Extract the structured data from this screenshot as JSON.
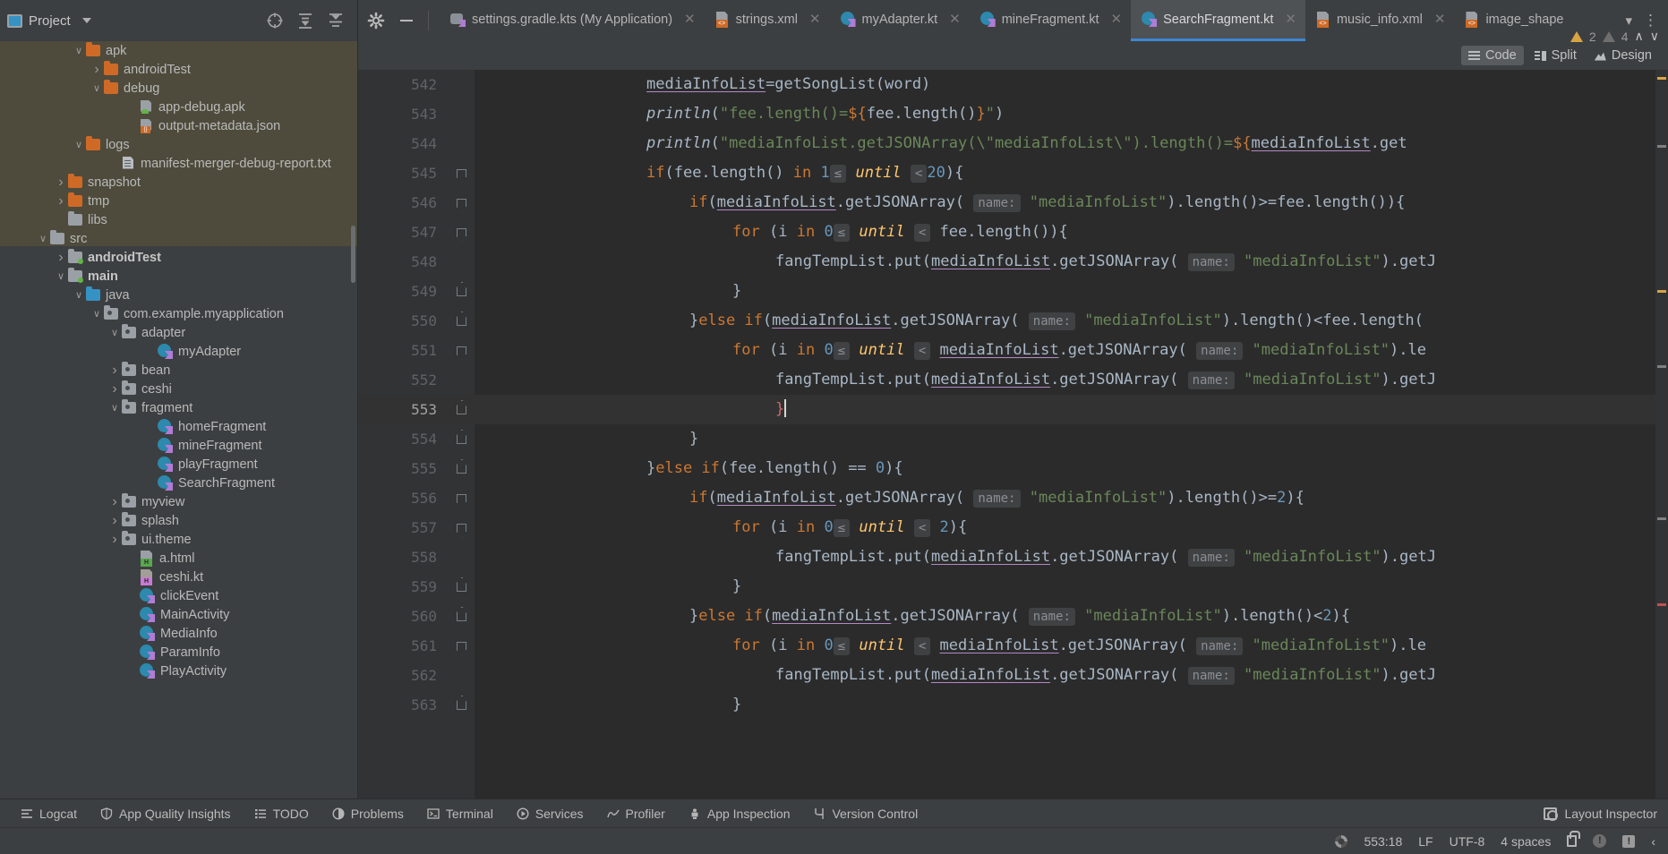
{
  "project_panel": {
    "title": "Project",
    "icons": [
      "target-icon",
      "collapse-all-icon",
      "expand-collapse-icon",
      "settings-gear-icon",
      "minimize-icon"
    ],
    "tree": [
      {
        "label": "apk",
        "indent": 4,
        "twisty": "v",
        "icon": "folder-orange",
        "bold": false,
        "hl": true
      },
      {
        "label": "androidTest",
        "indent": 5,
        "twisty": ">",
        "icon": "folder-orange",
        "bold": false,
        "hl": true
      },
      {
        "label": "debug",
        "indent": 5,
        "twisty": "v",
        "icon": "folder-orange",
        "bold": false,
        "hl": true
      },
      {
        "label": "app-debug.apk",
        "indent": 7,
        "twisty": "",
        "icon": "apk-file",
        "bold": false,
        "hl": true
      },
      {
        "label": "output-metadata.json",
        "indent": 7,
        "twisty": "",
        "icon": "json-file",
        "bold": false,
        "hl": true
      },
      {
        "label": "logs",
        "indent": 4,
        "twisty": "v",
        "icon": "folder-orange",
        "bold": false,
        "hl": true
      },
      {
        "label": "manifest-merger-debug-report.txt",
        "indent": 6,
        "twisty": "",
        "icon": "txt-file",
        "bold": false,
        "hl": true
      },
      {
        "label": "snapshot",
        "indent": 3,
        "twisty": ">",
        "icon": "folder-orange",
        "bold": false,
        "hl": true
      },
      {
        "label": "tmp",
        "indent": 3,
        "twisty": ">",
        "icon": "folder-orange",
        "bold": false,
        "hl": true
      },
      {
        "label": "libs",
        "indent": 3,
        "twisty": "",
        "icon": "folder-gray",
        "bold": false,
        "hl": false
      },
      {
        "label": "src",
        "indent": 2,
        "twisty": "v",
        "icon": "folder-gray",
        "bold": false,
        "hl": false
      },
      {
        "label": "androidTest",
        "indent": 3,
        "twisty": ">",
        "icon": "folder-src",
        "bold": true,
        "hl": false
      },
      {
        "label": "main",
        "indent": 3,
        "twisty": "v",
        "icon": "folder-src",
        "bold": true,
        "hl": false
      },
      {
        "label": "java",
        "indent": 4,
        "twisty": "v",
        "icon": "folder-blue",
        "bold": false,
        "hl": false
      },
      {
        "label": "com.example.myapplication",
        "indent": 5,
        "twisty": "v",
        "icon": "folder-pkg",
        "bold": false,
        "hl": false
      },
      {
        "label": "adapter",
        "indent": 6,
        "twisty": "v",
        "icon": "folder-pkg",
        "bold": false,
        "hl": false
      },
      {
        "label": "myAdapter",
        "indent": 8,
        "twisty": "",
        "icon": "kotlin-file",
        "bold": false,
        "hl": false
      },
      {
        "label": "bean",
        "indent": 6,
        "twisty": ">",
        "icon": "folder-pkg",
        "bold": false,
        "hl": false
      },
      {
        "label": "ceshi",
        "indent": 6,
        "twisty": ">",
        "icon": "folder-pkg",
        "bold": false,
        "hl": false
      },
      {
        "label": "fragment",
        "indent": 6,
        "twisty": "v",
        "icon": "folder-pkg",
        "bold": false,
        "hl": false
      },
      {
        "label": "homeFragment",
        "indent": 8,
        "twisty": "",
        "icon": "kotlin-file",
        "bold": false,
        "hl": false
      },
      {
        "label": "mineFragment",
        "indent": 8,
        "twisty": "",
        "icon": "kotlin-file",
        "bold": false,
        "hl": false
      },
      {
        "label": "playFragment",
        "indent": 8,
        "twisty": "",
        "icon": "kotlin-file",
        "bold": false,
        "hl": false
      },
      {
        "label": "SearchFragment",
        "indent": 8,
        "twisty": "",
        "icon": "kotlin-file",
        "bold": false,
        "hl": false
      },
      {
        "label": "myview",
        "indent": 6,
        "twisty": ">",
        "icon": "folder-pkg",
        "bold": false,
        "hl": false
      },
      {
        "label": "splash",
        "indent": 6,
        "twisty": ">",
        "icon": "folder-pkg",
        "bold": false,
        "hl": false
      },
      {
        "label": "ui.theme",
        "indent": 6,
        "twisty": ">",
        "icon": "folder-pkg",
        "bold": false,
        "hl": false
      },
      {
        "label": "a.html",
        "indent": 7,
        "twisty": "",
        "icon": "html-file",
        "bold": false,
        "hl": false
      },
      {
        "label": "ceshi.kt",
        "indent": 7,
        "twisty": "",
        "icon": "kotlin-script-file",
        "bold": false,
        "hl": false
      },
      {
        "label": "clickEvent",
        "indent": 7,
        "twisty": "",
        "icon": "kotlin-file",
        "bold": false,
        "hl": false
      },
      {
        "label": "MainActivity",
        "indent": 7,
        "twisty": "",
        "icon": "kotlin-file",
        "bold": false,
        "hl": false
      },
      {
        "label": "MediaInfo",
        "indent": 7,
        "twisty": "",
        "icon": "kotlin-file",
        "bold": false,
        "hl": false
      },
      {
        "label": "ParamInfo",
        "indent": 7,
        "twisty": "",
        "icon": "kotlin-file",
        "bold": false,
        "hl": false
      },
      {
        "label": "PlayActivity",
        "indent": 7,
        "twisty": "",
        "icon": "kotlin-file",
        "bold": false,
        "hl": false
      }
    ]
  },
  "tabs": [
    {
      "label": "settings.gradle.kts (My Application)",
      "icon": "gradle-file-icon",
      "active": false
    },
    {
      "label": "strings.xml",
      "icon": "xml-file-icon",
      "active": false
    },
    {
      "label": "myAdapter.kt",
      "icon": "kotlin-file-icon",
      "active": false
    },
    {
      "label": "mineFragment.kt",
      "icon": "kotlin-file-icon",
      "active": false
    },
    {
      "label": "SearchFragment.kt",
      "icon": "kotlin-file-icon",
      "active": true
    },
    {
      "label": "music_info.xml",
      "icon": "xml-file-icon",
      "active": false
    },
    {
      "label": "image_shape",
      "icon": "xml-file-icon",
      "active": false
    }
  ],
  "view_modes": [
    {
      "label": "Code",
      "active": true
    },
    {
      "label": "Split",
      "active": false
    },
    {
      "label": "Design",
      "active": false
    }
  ],
  "inspection": {
    "warning_count": "2",
    "weak_warning_count": "4",
    "up_label": "∧",
    "down_label": "∨"
  },
  "editor": {
    "first_line": 542,
    "current_line": 553,
    "lines": [
      {
        "n": 542,
        "fold": "",
        "cur": false,
        "html": "<span class=\"s-var\">mediaInfoList</span><span class=\"s-plain\">=getSongList(word)</span>"
      },
      {
        "n": 543,
        "fold": "",
        "cur": false,
        "html": "<span class=\"s-fn\">println</span><span class=\"s-plain\">(</span><span class=\"s-str\">\"fee.length()=</span><span class=\"s-tmpl\">${</span><span class=\"s-plain\">fee.length()</span><span class=\"s-tmpl\">}</span><span class=\"s-str\">\"</span><span class=\"s-plain\">)</span>"
      },
      {
        "n": 544,
        "fold": "",
        "cur": false,
        "html": "<span class=\"s-fn\">println</span><span class=\"s-plain\">(</span><span class=\"s-str\">\"mediaInfoList.getJSONArray(\\\"mediaInfoList\\\").length()=</span><span class=\"s-tmpl\">${</span><span class=\"s-var\">mediaInfoList</span><span class=\"s-plain\">.get</span>"
      },
      {
        "n": 545,
        "fold": "down",
        "cur": false,
        "html": "<span class=\"s-kw\">if</span><span class=\"s-plain\">(fee.length()</span> <span class=\"s-kw\">in</span> <span class=\"s-num\">1</span><span class=\"hint\">≤</span> <span class=\"s-soft\">until</span> <span class=\"hint\">&lt;</span><span class=\"s-num\">20</span><span class=\"s-plain\">){</span>"
      },
      {
        "n": 546,
        "fold": "down",
        "cur": false,
        "html": "<span class=\"s-kw\">if</span><span class=\"s-plain\">(</span><span class=\"s-var\">mediaInfoList</span><span class=\"s-plain\">.getJSONArray(</span> <span class=\"hint\">name:</span> <span class=\"s-str\">\"mediaInfoList\"</span><span class=\"s-plain\">).length()&gt;=fee.length()){</span>"
      },
      {
        "n": 547,
        "fold": "down",
        "cur": false,
        "html": "<span class=\"s-kw\">for</span> <span class=\"s-plain\">(i</span> <span class=\"s-kw\">in</span> <span class=\"s-num\">0</span><span class=\"hint\">≤</span> <span class=\"s-soft\">until</span> <span class=\"hint\">&lt;</span><span class=\"s-plain\"> fee.length()){</span>"
      },
      {
        "n": 548,
        "fold": "",
        "cur": false,
        "html": "<span class=\"s-plain\">fangTempList.put(</span><span class=\"s-var\">mediaInfoList</span><span class=\"s-plain\">.getJSONArray(</span> <span class=\"hint\">name:</span> <span class=\"s-str\">\"mediaInfoList\"</span><span class=\"s-plain\">).getJ</span>"
      },
      {
        "n": 549,
        "fold": "up",
        "cur": false,
        "html": "<span class=\"s-plain\">}</span>"
      },
      {
        "n": 550,
        "fold": "up",
        "cur": false,
        "html": "<span class=\"s-plain\">}</span><span class=\"s-kw\">else if</span><span class=\"s-plain\">(</span><span class=\"s-var\">mediaInfoList</span><span class=\"s-plain\">.getJSONArray(</span> <span class=\"hint\">name:</span> <span class=\"s-str\">\"mediaInfoList\"</span><span class=\"s-plain\">).length()&lt;fee.length(</span>"
      },
      {
        "n": 551,
        "fold": "down",
        "cur": false,
        "html": "<span class=\"s-kw\">for</span> <span class=\"s-plain\">(i</span> <span class=\"s-kw\">in</span> <span class=\"s-num\">0</span><span class=\"hint\">≤</span> <span class=\"s-soft\">until</span> <span class=\"hint\">&lt;</span> <span class=\"s-var\">mediaInfoList</span><span class=\"s-plain\">.getJSONArray(</span> <span class=\"hint\">name:</span> <span class=\"s-str\">\"mediaInfoList\"</span><span class=\"s-plain\">).le</span>"
      },
      {
        "n": 552,
        "fold": "",
        "cur": false,
        "html": "<span class=\"s-plain\">fangTempList.put(</span><span class=\"s-var\">mediaInfoList</span><span class=\"s-plain\">.getJSONArray(</span> <span class=\"hint\">name:</span> <span class=\"s-str\">\"mediaInfoList\"</span><span class=\"s-plain\">).getJ</span>"
      },
      {
        "n": 553,
        "fold": "up",
        "cur": true,
        "html": "<span class=\"brk-red\">}</span><span class=\"caret\"></span>"
      },
      {
        "n": 554,
        "fold": "up",
        "cur": false,
        "html": "<span class=\"s-plain\">}</span>"
      },
      {
        "n": 555,
        "fold": "up",
        "cur": false,
        "html": "<span class=\"s-plain\">}</span><span class=\"s-kw\">else if</span><span class=\"s-plain\">(fee.length() == </span><span class=\"s-num\">0</span><span class=\"s-plain\">){</span>"
      },
      {
        "n": 556,
        "fold": "down",
        "cur": false,
        "html": "<span class=\"s-kw\">if</span><span class=\"s-plain\">(</span><span class=\"s-var\">mediaInfoList</span><span class=\"s-plain\">.getJSONArray(</span> <span class=\"hint\">name:</span> <span class=\"s-str\">\"mediaInfoList\"</span><span class=\"s-plain\">).length()&gt;=</span><span class=\"s-num\">2</span><span class=\"s-plain\">){</span>"
      },
      {
        "n": 557,
        "fold": "down",
        "cur": false,
        "html": "<span class=\"s-kw\">for</span> <span class=\"s-plain\">(i</span> <span class=\"s-kw\">in</span> <span class=\"s-num\">0</span><span class=\"hint\">≤</span> <span class=\"s-soft\">until</span> <span class=\"hint\">&lt;</span> <span class=\"s-num\">2</span><span class=\"s-plain\">){</span>"
      },
      {
        "n": 558,
        "fold": "",
        "cur": false,
        "html": "<span class=\"s-plain\">fangTempList.put(</span><span class=\"s-var\">mediaInfoList</span><span class=\"s-plain\">.getJSONArray(</span> <span class=\"hint\">name:</span> <span class=\"s-str\">\"mediaInfoList\"</span><span class=\"s-plain\">).getJ</span>"
      },
      {
        "n": 559,
        "fold": "up",
        "cur": false,
        "html": "<span class=\"s-plain\">}</span>"
      },
      {
        "n": 560,
        "fold": "up",
        "cur": false,
        "html": "<span class=\"s-plain\">}</span><span class=\"s-kw\">else if</span><span class=\"s-plain\">(</span><span class=\"s-var\">mediaInfoList</span><span class=\"s-plain\">.getJSONArray(</span> <span class=\"hint\">name:</span> <span class=\"s-str\">\"mediaInfoList\"</span><span class=\"s-plain\">).length()&lt;</span><span class=\"s-num\">2</span><span class=\"s-plain\">){</span>"
      },
      {
        "n": 561,
        "fold": "down",
        "cur": false,
        "html": "<span class=\"s-kw\">for</span> <span class=\"s-plain\">(i</span> <span class=\"s-kw\">in</span> <span class=\"s-num\">0</span><span class=\"hint\">≤</span> <span class=\"s-soft\">until</span> <span class=\"hint\">&lt;</span> <span class=\"s-var\">mediaInfoList</span><span class=\"s-plain\">.getJSONArray(</span> <span class=\"hint\">name:</span> <span class=\"s-str\">\"mediaInfoList\"</span><span class=\"s-plain\">).le</span>"
      },
      {
        "n": 562,
        "fold": "",
        "cur": false,
        "html": "<span class=\"s-plain\">fangTempList.put(</span><span class=\"s-var\">mediaInfoList</span><span class=\"s-plain\">.getJSONArray(</span> <span class=\"hint\">name:</span> <span class=\"s-str\">\"mediaInfoList\"</span><span class=\"s-plain\">).getJ</span>"
      },
      {
        "n": 563,
        "fold": "up",
        "cur": false,
        "html": "<span class=\"s-plain\">}</span>"
      }
    ]
  },
  "tool_windows": [
    {
      "label": "Logcat",
      "icon": "logcat-icon"
    },
    {
      "label": "App Quality Insights",
      "icon": "shield-icon"
    },
    {
      "label": "TODO",
      "icon": "todo-list-icon"
    },
    {
      "label": "Problems",
      "icon": "problems-icon"
    },
    {
      "label": "Terminal",
      "icon": "terminal-icon"
    },
    {
      "label": "Services",
      "icon": "services-icon"
    },
    {
      "label": "Profiler",
      "icon": "profiler-icon"
    },
    {
      "label": "App Inspection",
      "icon": "app-inspection-icon"
    },
    {
      "label": "Version Control",
      "icon": "version-control-icon"
    }
  ],
  "right_tool_window": {
    "label": "Layout Inspector",
    "icon": "layout-inspector-icon"
  },
  "status_bar": {
    "caret_position": "553:18",
    "line_separator": "LF",
    "encoding": "UTF-8",
    "indent": "4 spaces",
    "lock_icon": "unlocked-icon",
    "notification_icon": "notification-icon",
    "event_log_icon": "event-log-icon"
  },
  "colors": {
    "accent": "#3e86d6",
    "warning": "#d9a343",
    "string": "#6a8759",
    "keyword": "#cc7832",
    "number": "#6897bb",
    "tree_highlight": "#4e4b3c"
  }
}
